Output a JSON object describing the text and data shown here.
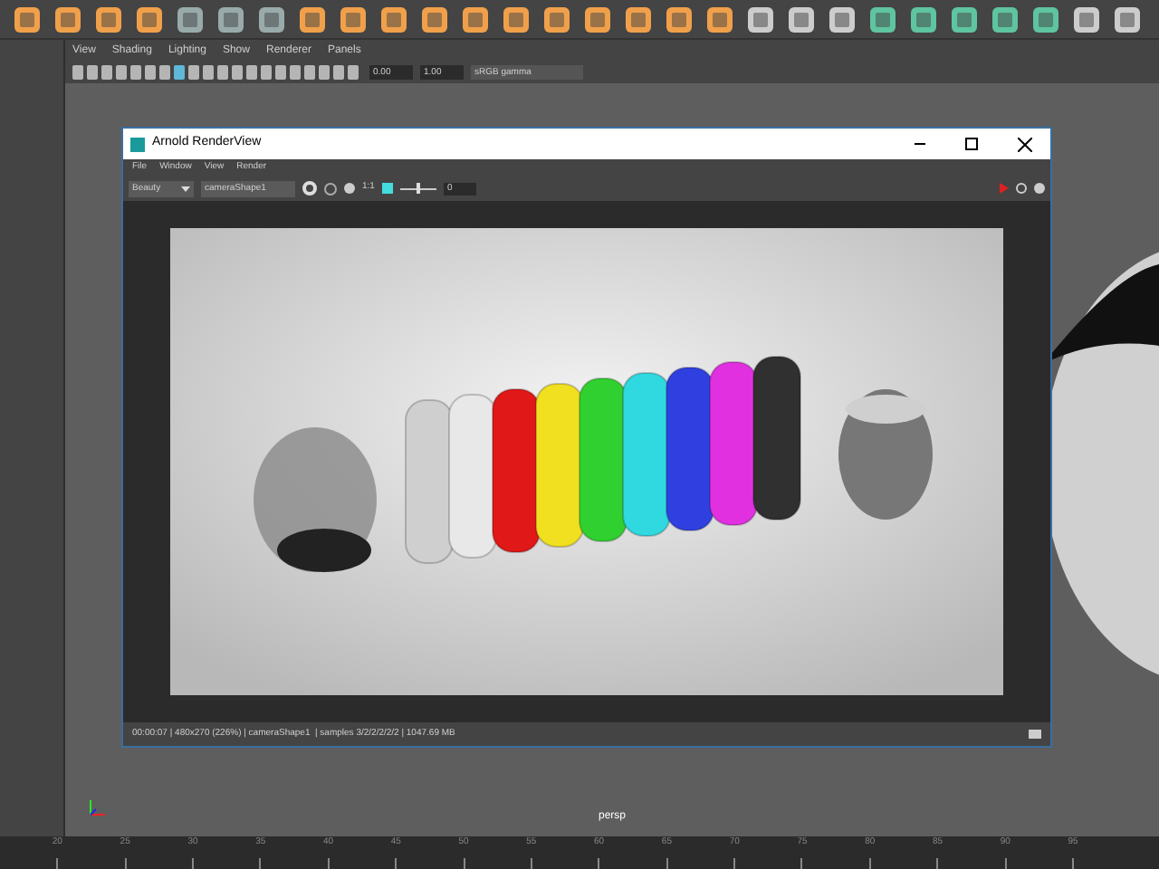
{
  "viewport": {
    "menu": [
      "View",
      "Shading",
      "Lighting",
      "Show",
      "Renderer",
      "Panels"
    ],
    "exposure": "0.00",
    "gamma": "1.00",
    "color_space": "sRGB gamma",
    "camera_label": "persp"
  },
  "render_view": {
    "title": "Arnold RenderView",
    "menu": [
      "File",
      "Window",
      "View",
      "Render"
    ],
    "aov": "Beauty",
    "camera": "cameraShape1",
    "ratio": "1:1",
    "slider": {
      "level": 0.5
    },
    "slider_value": "0",
    "status": "00:00:07 | 480x270 (226%) | cameraShape1  | samples 3/2/2/2/2/2 | 1047.69 MB"
  },
  "timeline": {
    "ticks": [
      "20",
      "25",
      "30",
      "35",
      "40",
      "45",
      "50",
      "55",
      "60",
      "65",
      "70",
      "75",
      "80",
      "85",
      "90",
      "95"
    ]
  }
}
